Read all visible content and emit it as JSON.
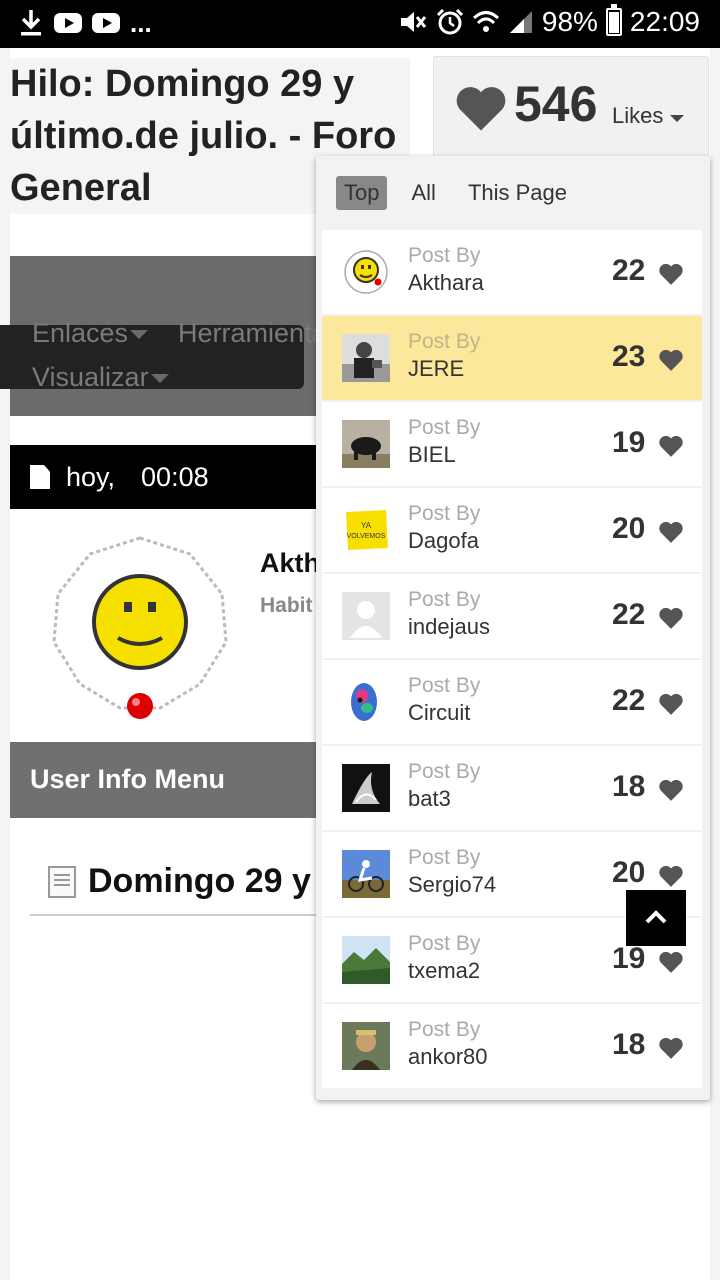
{
  "status_bar": {
    "battery": "98%",
    "time": "22:09",
    "more": "..."
  },
  "thread": {
    "title": "Hilo: Domingo 29 y último.de julio. - Foro General"
  },
  "nav": {
    "item1": "Enlaces",
    "item2": "Herramientas",
    "item3": "Visualizar"
  },
  "post": {
    "date": "hoy,",
    "time": "00:08",
    "username": "Akth",
    "user_title": "Habit",
    "title": "Domingo 29 y"
  },
  "user_info_menu": "User Info Menu",
  "likes": {
    "count": "546",
    "label": "Likes",
    "tabs": [
      "Top",
      "All",
      "This Page"
    ],
    "entries": [
      {
        "prefix": "Post By",
        "name": "Akthara",
        "count": "22",
        "avatar": "smiley"
      },
      {
        "prefix": "Post By",
        "name": "JERE",
        "count": "23",
        "avatar": "photo-man"
      },
      {
        "prefix": "Post By",
        "name": "BIEL",
        "count": "19",
        "avatar": "bull"
      },
      {
        "prefix": "Post By",
        "name": "Dagofa",
        "count": "20",
        "avatar": "sticky-note"
      },
      {
        "prefix": "Post By",
        "name": "indejaus",
        "count": "22",
        "avatar": "default-user"
      },
      {
        "prefix": "Post By",
        "name": "Circuit",
        "count": "22",
        "avatar": "colorful-face"
      },
      {
        "prefix": "Post By",
        "name": "bat3",
        "count": "18",
        "avatar": "dark-photo"
      },
      {
        "prefix": "Post By",
        "name": "Sergio74",
        "count": "20",
        "avatar": "cyclist"
      },
      {
        "prefix": "Post By",
        "name": "txema2",
        "count": "19",
        "avatar": "landscape"
      },
      {
        "prefix": "Post By",
        "name": "ankor80",
        "count": "18",
        "avatar": "portrait"
      }
    ],
    "sticky_text": "YA VOLVEMOS"
  },
  "colors": {
    "highlight": "#fce89a",
    "header_gray": "#707070",
    "heart": "#555555"
  }
}
